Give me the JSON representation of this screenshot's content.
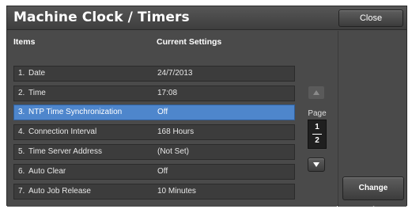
{
  "header": {
    "title": "Machine Clock / Timers",
    "close_label": "Close"
  },
  "table": {
    "col_items": "Items",
    "col_settings": "Current Settings",
    "rows": [
      {
        "num": "1.",
        "label": "Date",
        "value": "24/7/2013",
        "selected": false
      },
      {
        "num": "2.",
        "label": "Time",
        "value": "17:08",
        "selected": false
      },
      {
        "num": "3.",
        "label": "NTP Time Synchronization",
        "value": "Off",
        "selected": true
      },
      {
        "num": "4.",
        "label": "Connection Interval",
        "value": "168 Hours",
        "selected": false
      },
      {
        "num": "5.",
        "label": "Time Server Address",
        "value": "(Not Set)",
        "selected": false
      },
      {
        "num": "6.",
        "label": "Auto Clear",
        "value": "Off",
        "selected": false
      },
      {
        "num": "7.",
        "label": "Auto Job Release",
        "value": "10 Minutes",
        "selected": false
      }
    ]
  },
  "pager": {
    "label": "Page",
    "current": "1",
    "total": "2",
    "up_icon": "triangle-up-icon",
    "down_icon": "triangle-down-icon"
  },
  "actions": {
    "change_settings_label": "Change Settings"
  },
  "colors": {
    "selected_row": "#4e86cc",
    "row_bg": "#3c3c3c",
    "panel_bg": "#4a4a4a"
  }
}
